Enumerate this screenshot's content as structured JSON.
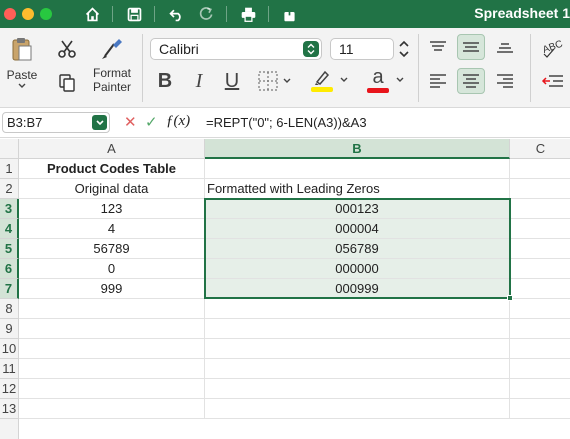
{
  "window": {
    "title": "Spreadsheet 1"
  },
  "ribbon": {
    "paste_label": "Paste",
    "format_painter_label_line1": "Format",
    "format_painter_label_line2": "Painter",
    "font_name": "Calibri",
    "font_size": "11",
    "bold_glyph": "B",
    "italic_glyph": "I",
    "underline_glyph": "U",
    "font_color_glyph": "a",
    "highlight_color": "#ffeb00",
    "font_color": "#e8141b"
  },
  "formula_bar": {
    "name_box": "B3:B7",
    "cancel_glyph": "✕",
    "enter_glyph": "✓",
    "fx_label": "ƒ(x)",
    "formula": "=REPT(\"0\"; 6-LEN(A3))&A3"
  },
  "grid": {
    "columns": [
      "A",
      "B",
      "C"
    ],
    "selected_column": "B",
    "rows": [
      "1",
      "2",
      "3",
      "4",
      "5",
      "6",
      "7",
      "8",
      "9",
      "10",
      "11",
      "12",
      "13"
    ],
    "selected_rows": [
      "3",
      "4",
      "5",
      "6",
      "7"
    ],
    "cells": {
      "A1": "Product Codes Table",
      "A2": "Original data",
      "B2": "Formatted with Leading Zeros",
      "A3": "123",
      "B3": "000123",
      "A4": "4",
      "B4": "000004",
      "A5": "56789",
      "B5": "056789",
      "A6": "0",
      "B6": "000000",
      "A7": "999",
      "B7": "000999"
    }
  },
  "colors": {
    "accent": "#217346",
    "selection_fill": "#e6efe8"
  }
}
